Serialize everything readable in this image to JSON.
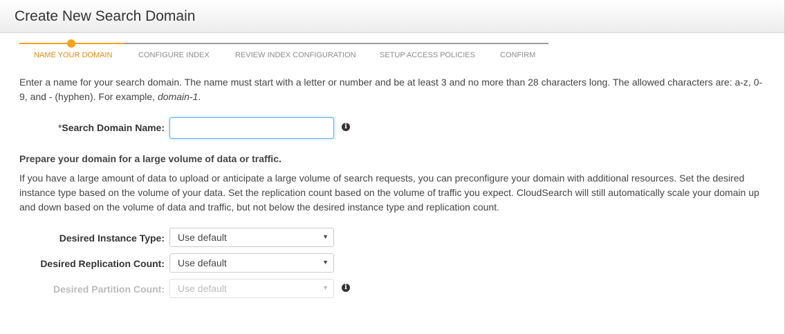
{
  "header": {
    "title": "Create New Search Domain"
  },
  "wizard": {
    "steps": [
      {
        "label": "NAME YOUR DOMAIN",
        "active": true
      },
      {
        "label": "CONFIGURE INDEX",
        "active": false
      },
      {
        "label": "REVIEW INDEX CONFIGURATION",
        "active": false
      },
      {
        "label": "SETUP ACCESS POLICIES",
        "active": false
      },
      {
        "label": "CONFIRM",
        "active": false
      }
    ],
    "colors": {
      "active": "#f7a21b",
      "inactive": "#9a9a9a"
    }
  },
  "intro": {
    "text": "Enter a name for your search domain. The name must start with a letter or number and be at least 3 and no more than 28 characters long. The allowed characters are: a-z, 0-9, and - (hyphen). For example, ",
    "example": "domain-1",
    "suffix": "."
  },
  "domain_name": {
    "required_mark": "*",
    "label": "Search Domain Name:",
    "value": "",
    "placeholder": "",
    "info_icon": "info-icon"
  },
  "prepare": {
    "heading": "Prepare your domain for a large volume of data or traffic.",
    "text": "If you have a large amount of data to upload or anticipate a large volume of search requests, you can preconfigure your domain with additional resources. Set the desired instance type based on the volume of your data. Set the replication count based on the volume of traffic you expect. CloudSearch will still automatically scale your domain up and down based on the volume of data and traffic, but not below the desired instance type and replication count."
  },
  "instance_type": {
    "label": "Desired Instance Type:",
    "selected": "Use default"
  },
  "replication_count": {
    "label": "Desired Replication Count:",
    "selected": "Use default"
  },
  "partition_count": {
    "label": "Desired Partition Count:",
    "selected": "Use default",
    "disabled": true,
    "info_icon": "info-icon"
  }
}
